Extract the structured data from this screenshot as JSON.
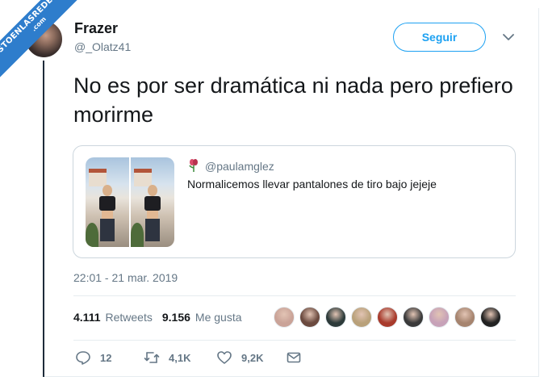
{
  "watermark": {
    "line1": "VISTOENLASREDES",
    "line2": ".com"
  },
  "author": {
    "name": "Frazer",
    "handle": "@_Olatz41"
  },
  "follow_button": {
    "label": "Seguir"
  },
  "tweet": {
    "text": "No es por ser dramática ni nada pero prefiero morirme"
  },
  "quoted": {
    "handle": "@paulamglez",
    "text": "Normalicemos llevar pantalones de tiro bajo jejeje"
  },
  "timestamp": "22:01 - 21 mar. 2019",
  "stats": {
    "retweets_count": "4.111",
    "retweets_label": "Retweets",
    "likes_count": "9.156",
    "likes_label": "Me gusta"
  },
  "likers_colors": [
    "#caa398",
    "#6b4a3f",
    "#2d3b3a",
    "#b9a17a",
    "#a83a2c",
    "#3a3a3a",
    "#c7a2b8",
    "#a6846f",
    "#222222"
  ],
  "actions": {
    "reply_count": "12",
    "retweet_count": "4,1K",
    "like_count": "9,2K"
  },
  "colors": {
    "accent": "#1da1f2",
    "secondary_text": "#657786"
  }
}
